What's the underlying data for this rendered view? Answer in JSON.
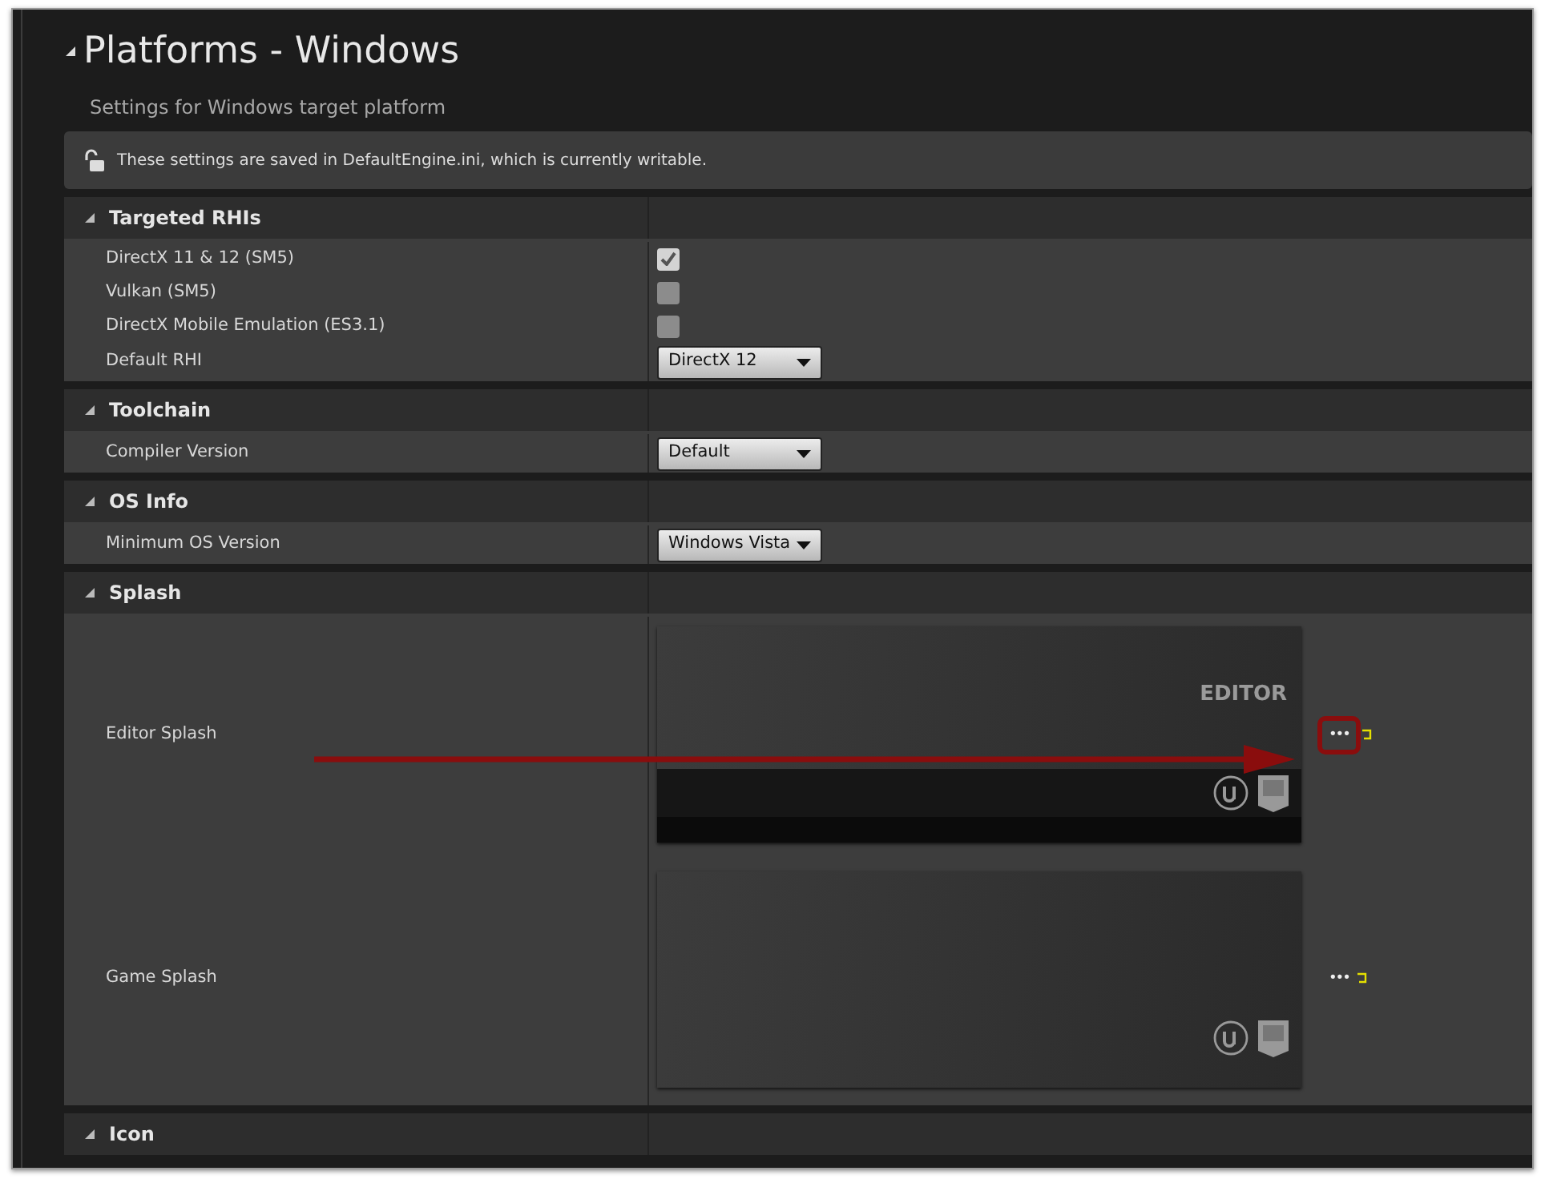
{
  "title": "Platforms - Windows",
  "title_expanded": true,
  "subtitle": "Settings for Windows target platform",
  "notice": "These settings are saved in DefaultEngine.ini, which is currently writable.",
  "sections": [
    {
      "title": "Targeted RHIs",
      "expanded": true,
      "rows": [
        {
          "kind": "checkbox",
          "label": "DirectX 11 & 12 (SM5)",
          "checked": true
        },
        {
          "kind": "checkbox",
          "label": "Vulkan (SM5)",
          "checked": false
        },
        {
          "kind": "checkbox",
          "label": "DirectX Mobile Emulation (ES3.1)",
          "checked": false
        },
        {
          "kind": "dropdown",
          "label": "Default RHI",
          "value": "DirectX 12"
        }
      ]
    },
    {
      "title": "Toolchain",
      "expanded": true,
      "rows": [
        {
          "kind": "dropdown",
          "label": "Compiler Version",
          "value": "Default"
        }
      ]
    },
    {
      "title": "OS Info",
      "expanded": true,
      "rows": [
        {
          "kind": "dropdown",
          "label": "Minimum OS Version",
          "value": "Windows Vista"
        }
      ]
    },
    {
      "title": "Splash",
      "expanded": true,
      "rows": [
        {
          "kind": "image",
          "label": "Editor Splash",
          "caption": "EDITOR",
          "browse": "•••",
          "highlighted": true
        },
        {
          "kind": "image",
          "label": "Game Splash",
          "browse": "•••",
          "highlighted": false
        }
      ]
    },
    {
      "title": "Icon",
      "expanded": true
    }
  ]
}
